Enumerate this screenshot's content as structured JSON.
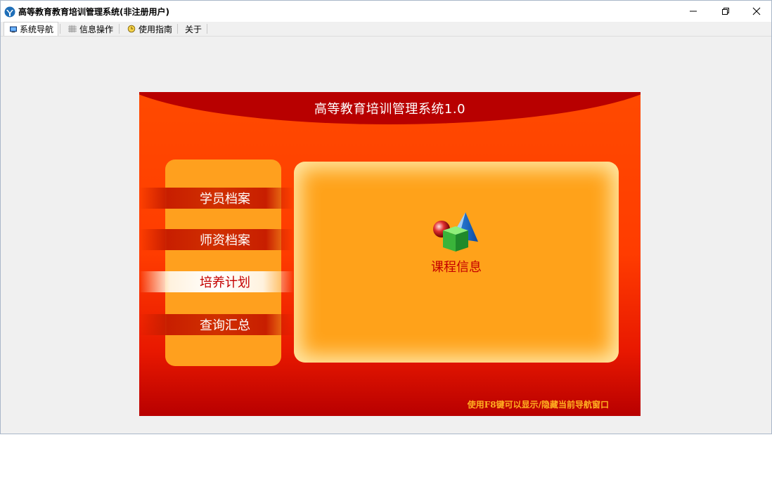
{
  "window": {
    "title": "高等教育教育培训管理系统(非注册用户)",
    "controls": {
      "minimize_icon": "minimize-icon",
      "restore_icon": "restore-icon",
      "close_icon": "close-icon"
    }
  },
  "tabs": [
    {
      "label": "系统导航",
      "icon": "monitor-icon",
      "active": true
    },
    {
      "label": "信息操作",
      "icon": "grid-icon",
      "active": false
    },
    {
      "label": "使用指南",
      "icon": "clock-icon",
      "active": false
    },
    {
      "label": "关于",
      "icon": "",
      "active": false
    }
  ],
  "banner": {
    "title": "高等教育培训管理系统1.0",
    "nav": [
      {
        "label": "学员档案",
        "selected": false
      },
      {
        "label": "师资档案",
        "selected": false
      },
      {
        "label": "培养计划",
        "selected": true
      },
      {
        "label": "查询汇总",
        "selected": false
      }
    ],
    "module": {
      "label": "课程信息",
      "icon": "shapes-icon"
    },
    "hint": "使用F8键可以显示/隐藏当前导航窗口"
  },
  "colors": {
    "banner_red": "#b80000",
    "banner_orange": "#ff4a00",
    "panel_orange": "#ffa01e",
    "hint_text": "#ffb020"
  }
}
